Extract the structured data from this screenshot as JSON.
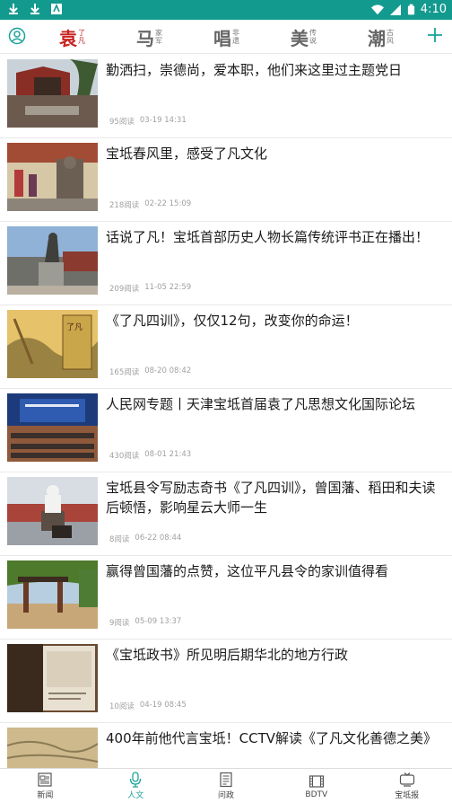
{
  "status": {
    "time": "4:10",
    "accent": "#139a8f"
  },
  "topnav": {
    "categories": [
      {
        "big": "袁",
        "s1": "了",
        "s2": "凡"
      },
      {
        "big": "马",
        "s1": "家",
        "s2": "军"
      },
      {
        "big": "唱",
        "s1": "非",
        "s2": "遗"
      },
      {
        "big": "美",
        "s1": "传",
        "s2": "说"
      },
      {
        "big": "潮",
        "s1": "古",
        "s2": "风"
      }
    ],
    "active_color": "#c8231f",
    "accent": "#1aa39a"
  },
  "news": [
    {
      "title": "勤洒扫，崇德尚，爱本职，他们来这里过主题党日",
      "reads": "95阅读",
      "date": "03-19 14:31"
    },
    {
      "title": "宝坻春风里，感受了凡文化",
      "reads": "218阅读",
      "date": "02-22 15:09"
    },
    {
      "title": "话说了凡！宝坻首部历史人物长篇传统评书正在播出！",
      "reads": "209阅读",
      "date": "11-05 22:59"
    },
    {
      "title": "《了凡四训》，仅仅12句，改变你的命运！",
      "reads": "165阅读",
      "date": "08-20 08:42"
    },
    {
      "title": "人民网专题丨天津宝坻首届袁了凡思想文化国际论坛",
      "reads": "430阅读",
      "date": "08-01 21:43"
    },
    {
      "title": "宝坻县令写励志奇书《了凡四训》，曾国藩、稻田和夫读后顿悟，影响星云大师一生",
      "reads": "8阅读",
      "date": "06-22 08:44"
    },
    {
      "title": "赢得曾国藩的点赞，这位平凡县令的家训值得看",
      "reads": "9阅读",
      "date": "05-09 13:37"
    },
    {
      "title": "《宝坻政书》所见明后期华北的地方行政",
      "reads": "10阅读",
      "date": "04-19 08:45"
    },
    {
      "title": "400年前他代言宝坻！CCTV解读《了凡文化善德之美》",
      "reads": "",
      "date": ""
    }
  ],
  "tabs": [
    {
      "label": "新闻",
      "icon": "newspaper-icon"
    },
    {
      "label": "人文",
      "icon": "microphone-icon"
    },
    {
      "label": "问政",
      "icon": "document-icon"
    },
    {
      "label": "BDTV",
      "icon": "film-icon"
    },
    {
      "label": "宝坻报",
      "icon": "tv-icon"
    }
  ],
  "active_tab": "人文"
}
